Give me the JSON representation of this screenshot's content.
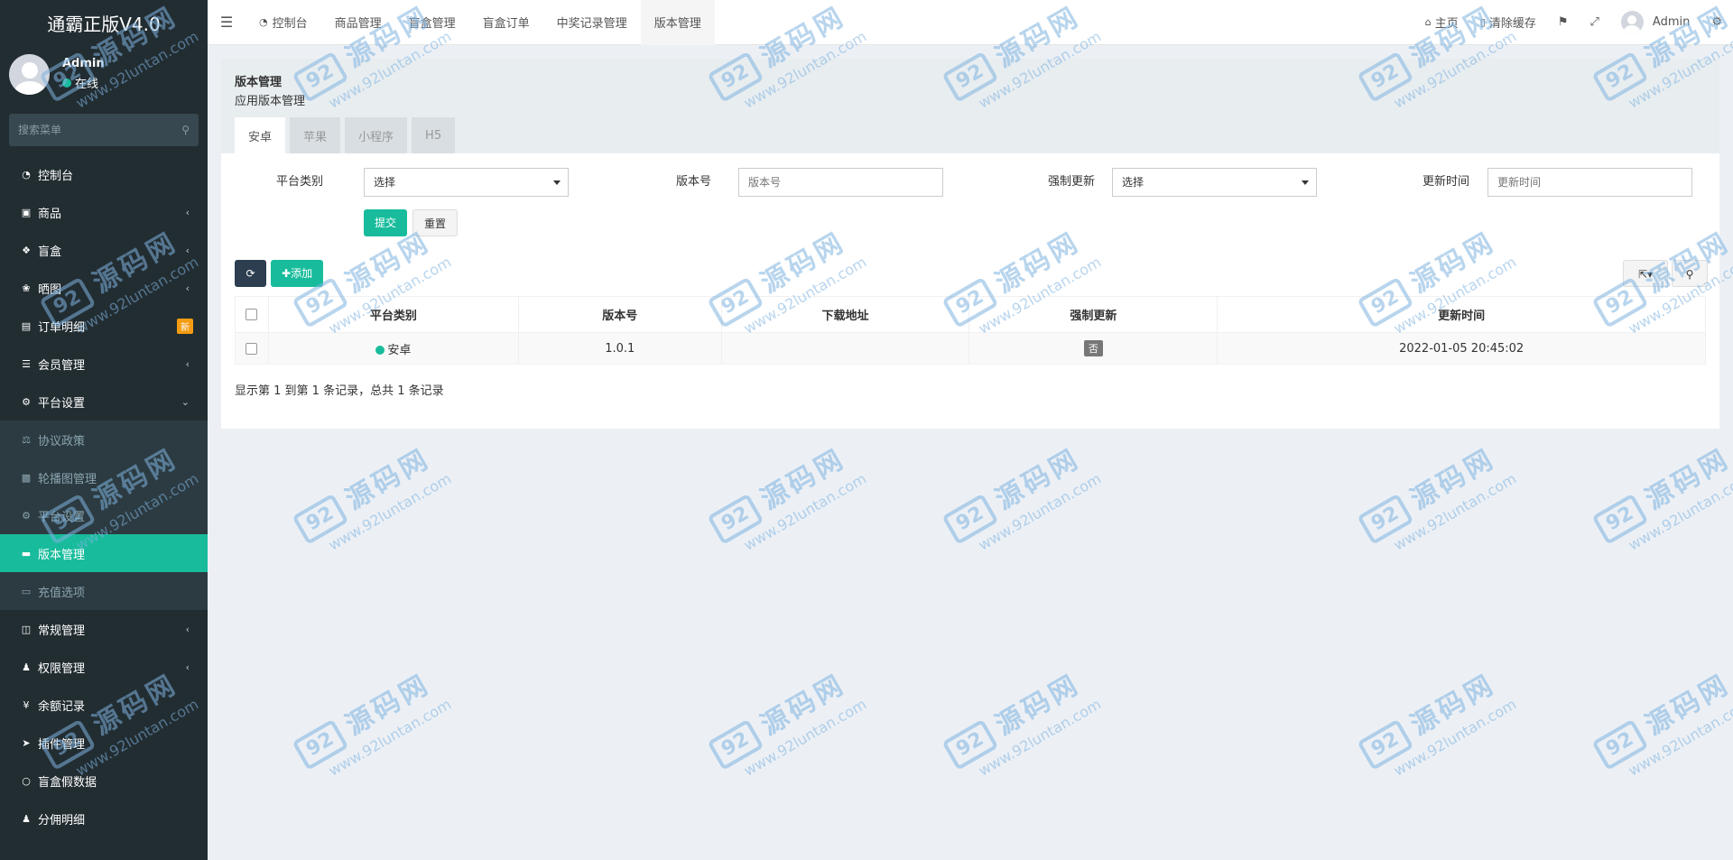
{
  "brand": "通霸正版V4.0",
  "user": {
    "name": "Admin",
    "status": "在线"
  },
  "menu_search": {
    "placeholder": "搜索菜单"
  },
  "sidebar": {
    "items": [
      {
        "label": "控制台",
        "icon": "dashboard-icon"
      },
      {
        "label": "商品",
        "icon": "shopping-bag-icon"
      },
      {
        "label": "盲盒",
        "icon": "cube-icon"
      },
      {
        "label": "晒图",
        "icon": "dropbox-icon"
      },
      {
        "label": "订单明细",
        "icon": "cart-icon",
        "badge": "新"
      },
      {
        "label": "会员管理",
        "icon": "list-icon"
      },
      {
        "label": "平台设置",
        "icon": "cog-icon"
      }
    ],
    "sub_items": [
      {
        "label": "协议政策",
        "icon": "balance-icon"
      },
      {
        "label": "轮播图管理",
        "icon": "image-icon"
      },
      {
        "label": "平台设置",
        "icon": "cog-icon"
      },
      {
        "label": "版本管理",
        "icon": "id-card-icon"
      },
      {
        "label": "充值选项",
        "icon": "credit-card-icon"
      }
    ],
    "items2": [
      {
        "label": "常规管理",
        "icon": "database-icon"
      },
      {
        "label": "权限管理",
        "icon": "group-icon"
      },
      {
        "label": "余额记录",
        "icon": "yen-icon"
      },
      {
        "label": "插件管理",
        "icon": "rocket-icon"
      },
      {
        "label": "盲盒假数据",
        "icon": "circle-icon"
      },
      {
        "label": "分佣明细",
        "icon": "users-icon"
      }
    ]
  },
  "header": {
    "tabs": [
      {
        "label": "控制台",
        "icon": "dashboard-icon"
      },
      {
        "label": "商品管理"
      },
      {
        "label": "盲盒管理"
      },
      {
        "label": "盲盒订单"
      },
      {
        "label": "中奖记录管理"
      },
      {
        "label": "版本管理"
      }
    ],
    "home": "主页",
    "clear_cache": "清除缓存",
    "admin": "Admin"
  },
  "panel": {
    "title": "版本管理",
    "subtitle": "应用版本管理",
    "tabs": [
      "安卓",
      "苹果",
      "小程序",
      "H5"
    ]
  },
  "filter": {
    "platform_label": "平台类别",
    "platform_value": "选择",
    "version_label": "版本号",
    "version_placeholder": "版本号",
    "force_label": "强制更新",
    "force_value": "选择",
    "time_label": "更新时间",
    "time_placeholder": "更新时间",
    "submit": "提交",
    "reset": "重置"
  },
  "toolbar": {
    "add": "添加"
  },
  "table": {
    "columns": [
      "平台类别",
      "版本号",
      "下载地址",
      "强制更新",
      "更新时间"
    ],
    "rows": [
      {
        "platform": "安卓",
        "version": "1.0.1",
        "url": "",
        "force": "否",
        "time": "2022-01-05 20:45:02"
      }
    ]
  },
  "pager": "显示第 1 到第 1 条记录，总共 1 条记录",
  "watermark": {
    "cn": "源码网",
    "logo": "92",
    "url": "www.92luntan.com"
  },
  "colors": {
    "accent": "#18bc9c",
    "sidebar": "#222d32",
    "badge": "#f39c12"
  }
}
